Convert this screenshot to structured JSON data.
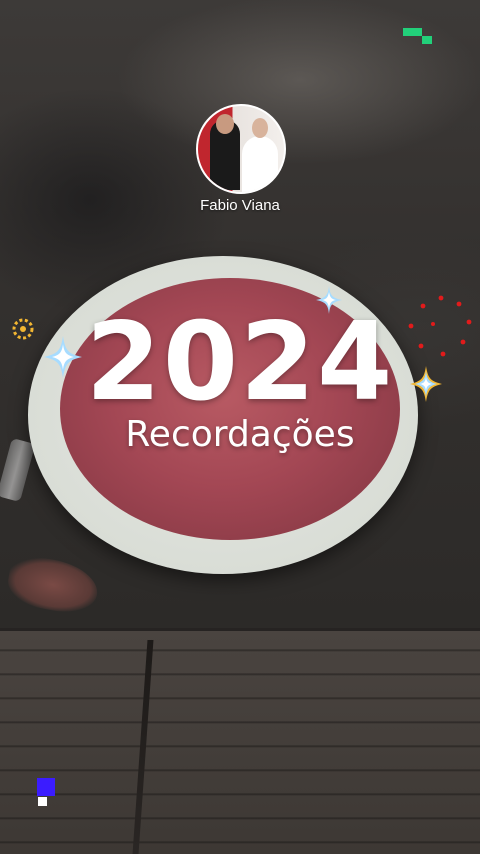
{
  "story": {
    "user_name": "Fabio Viana",
    "year": "2024",
    "subtitle": "Recordações"
  },
  "colors": {
    "accent_green": "#22d07a",
    "accent_blue": "#3b1cff",
    "sparkle_blue": "#a7dcff",
    "sparkle_gold": "#f2b632",
    "red_dots": "#e11b1b"
  },
  "icons": {
    "sparkle": "four-point-star-icon",
    "ring": "dotted-ring-icon",
    "pixels": "pixel-blocks-icon"
  }
}
